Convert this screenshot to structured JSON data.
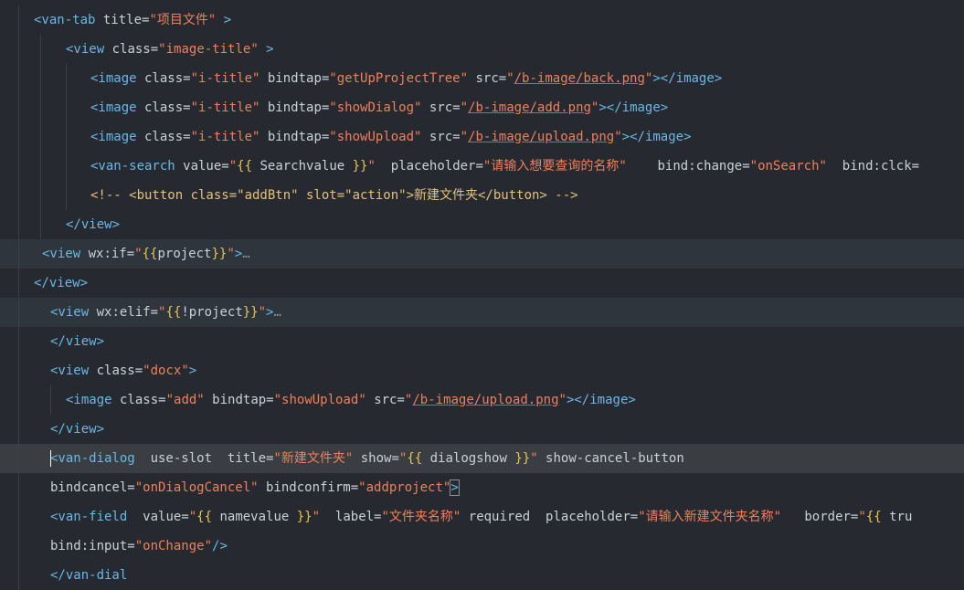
{
  "editor": {
    "lines": [
      {
        "indent": 37,
        "guides": [
          20
        ],
        "tokens": [
          [
            "tag",
            "<van-tab"
          ],
          [
            "at",
            " title="
          ],
          [
            "st",
            "\"项目文件\""
          ],
          [
            "tag",
            " >"
          ]
        ]
      },
      {
        "indent": 72,
        "guides": [
          20,
          44
        ],
        "tokens": [
          [
            "tag",
            "<view"
          ],
          [
            "at",
            " class="
          ],
          [
            "st",
            "\"image-title\""
          ],
          [
            "tag",
            " >"
          ]
        ]
      },
      {
        "indent": 99,
        "guides": [
          20,
          44,
          72
        ],
        "tokens": [
          [
            "tag",
            "<image"
          ],
          [
            "at",
            " class="
          ],
          [
            "st",
            "\"i-title\""
          ],
          [
            "at",
            " bindtap="
          ],
          [
            "st",
            "\"getUpProjectTree\""
          ],
          [
            "at",
            " src="
          ],
          [
            "st",
            "\""
          ],
          [
            "stu",
            "/b-image/back.png"
          ],
          [
            "st",
            "\""
          ],
          [
            "tag",
            "></image>"
          ]
        ]
      },
      {
        "indent": 99,
        "guides": [
          20,
          44,
          72
        ],
        "tokens": [
          [
            "tag",
            "<image"
          ],
          [
            "at",
            " class="
          ],
          [
            "st",
            "\"i-title\""
          ],
          [
            "at",
            " bindtap="
          ],
          [
            "st",
            "\"showDialog\""
          ],
          [
            "at",
            " src="
          ],
          [
            "st",
            "\""
          ],
          [
            "stu",
            "/b-image/add.png"
          ],
          [
            "st",
            "\""
          ],
          [
            "tag",
            "></image>"
          ]
        ]
      },
      {
        "indent": 99,
        "guides": [
          20,
          44,
          72
        ],
        "tokens": [
          [
            "tag",
            "<image"
          ],
          [
            "at",
            " class="
          ],
          [
            "st",
            "\"i-title\""
          ],
          [
            "at",
            " bindtap="
          ],
          [
            "st",
            "\"showUpload\""
          ],
          [
            "at",
            " src="
          ],
          [
            "st",
            "\""
          ],
          [
            "stu",
            "/b-image/upload.png"
          ],
          [
            "st",
            "\""
          ],
          [
            "tag",
            "></image>"
          ]
        ]
      },
      {
        "indent": 99,
        "guides": [
          20,
          44,
          72
        ],
        "tokens": [
          [
            "tag",
            "<van-search"
          ],
          [
            "at",
            " value="
          ],
          [
            "st",
            "\""
          ],
          [
            "bk",
            "{{"
          ],
          [
            "p",
            " Searchvalue "
          ],
          [
            "bk",
            "}}"
          ],
          [
            "st",
            "\""
          ],
          [
            "at",
            "  placeholder="
          ],
          [
            "st",
            "\"请输入想要查询的名称\""
          ],
          [
            "at",
            "    bind:change="
          ],
          [
            "st",
            "\"onSearch\""
          ],
          [
            "at",
            "  bind:clck="
          ]
        ]
      },
      {
        "indent": 99,
        "guides": [
          20,
          44,
          72
        ],
        "tokens": [
          [
            "cm",
            "<!-- <button class=\"addBtn\" slot=\"action\">新建文件夹</button> -->"
          ]
        ]
      },
      {
        "indent": 72,
        "guides": [
          20,
          44
        ],
        "tokens": [
          [
            "tag",
            "</view>"
          ]
        ]
      },
      {
        "indent": 46,
        "guides": [
          20
        ],
        "hl": true,
        "tokens": [
          [
            "tag",
            "<view"
          ],
          [
            "at",
            " wx:if="
          ],
          [
            "st",
            "\""
          ],
          [
            "bk",
            "{{"
          ],
          [
            "p",
            "project"
          ],
          [
            "bk",
            "}}"
          ],
          [
            "st",
            "\""
          ],
          [
            "tag",
            ">"
          ],
          [
            "fold",
            "…"
          ]
        ]
      },
      {
        "indent": 37,
        "guides": [
          20
        ],
        "tokens": [
          [
            "tag",
            "</view>"
          ]
        ]
      },
      {
        "indent": 55,
        "guides": [
          20
        ],
        "hl": true,
        "tokens": [
          [
            "tag",
            "<view"
          ],
          [
            "at",
            " wx:elif="
          ],
          [
            "st",
            "\""
          ],
          [
            "bk",
            "{{"
          ],
          [
            "p",
            "!project"
          ],
          [
            "bk",
            "}}"
          ],
          [
            "st",
            "\""
          ],
          [
            "tag",
            ">"
          ],
          [
            "fold",
            "…"
          ]
        ]
      },
      {
        "indent": 55,
        "guides": [
          20
        ],
        "tokens": [
          [
            "tag",
            "</view>"
          ]
        ]
      },
      {
        "indent": 55,
        "guides": [
          20
        ],
        "tokens": [
          [
            "tag",
            "<view"
          ],
          [
            "at",
            " class="
          ],
          [
            "st",
            "\"docx\""
          ],
          [
            "tag",
            ">"
          ]
        ]
      },
      {
        "indent": 72,
        "guides": [
          20,
          55
        ],
        "tokens": [
          [
            "tag",
            "<image"
          ],
          [
            "at",
            " class="
          ],
          [
            "st",
            "\"add\""
          ],
          [
            "at",
            " bindtap="
          ],
          [
            "st",
            "\"showUpload\""
          ],
          [
            "at",
            " src="
          ],
          [
            "st",
            "\""
          ],
          [
            "stu",
            "/b-image/upload.png"
          ],
          [
            "st",
            "\""
          ],
          [
            "tag",
            "></image>"
          ]
        ]
      },
      {
        "indent": 55,
        "guides": [
          20
        ],
        "tokens": [
          [
            "tag",
            "</view>"
          ]
        ]
      },
      {
        "indent": 55,
        "guides": [
          20
        ],
        "cur": true,
        "tokens": [
          [
            "cursor",
            ""
          ],
          [
            "tag",
            "<van-dialog"
          ],
          [
            "at",
            "  use-slot  title="
          ],
          [
            "st",
            "\"新建文件夹\""
          ],
          [
            "at",
            " show="
          ],
          [
            "st",
            "\""
          ],
          [
            "bk",
            "{{"
          ],
          [
            "p",
            " dialogshow "
          ],
          [
            "bk",
            "}}"
          ],
          [
            "st",
            "\""
          ],
          [
            "at",
            " show-cancel-button"
          ]
        ]
      },
      {
        "indent": 55,
        "guides": [
          20
        ],
        "tokens": [
          [
            "at",
            "bindcancel="
          ],
          [
            "st",
            "\"onDialogCancel\""
          ],
          [
            "at",
            " bindconfirm="
          ],
          [
            "st",
            "\"addproject\""
          ],
          [
            "tagbox",
            ">"
          ]
        ]
      },
      {
        "indent": 55,
        "guides": [
          20
        ],
        "tokens": [
          [
            "tag",
            "<van-field"
          ],
          [
            "at",
            "  value="
          ],
          [
            "st",
            "\""
          ],
          [
            "bk",
            "{{"
          ],
          [
            "p",
            " namevalue "
          ],
          [
            "bk",
            "}}"
          ],
          [
            "st",
            "\""
          ],
          [
            "at",
            "  label="
          ],
          [
            "st",
            "\"文件夹名称\""
          ],
          [
            "at",
            " required  placeholder="
          ],
          [
            "st",
            "\"请输入新建文件夹名称\""
          ],
          [
            "at",
            "   border="
          ],
          [
            "st",
            "\""
          ],
          [
            "bk",
            "{{"
          ],
          [
            "p",
            " tru"
          ]
        ]
      },
      {
        "indent": 55,
        "guides": [
          20
        ],
        "tokens": [
          [
            "at",
            "bind:input="
          ],
          [
            "st",
            "\"onChange\""
          ],
          [
            "tag",
            "/>"
          ]
        ]
      },
      {
        "indent": 55,
        "guides": [
          20
        ],
        "tokens": [
          [
            "tag",
            "</van-dial"
          ]
        ]
      }
    ]
  }
}
